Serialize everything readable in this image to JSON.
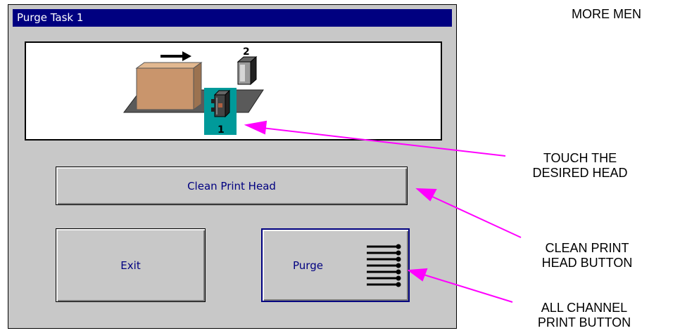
{
  "window": {
    "title": "Purge Task 1"
  },
  "scene": {
    "head_top_label": "2",
    "head_bottom_label": "1",
    "highlight_color": "#009a9a"
  },
  "buttons": {
    "clean_print_head": "Clean Print Head",
    "exit": "Exit",
    "purge": "Purge"
  },
  "callouts": {
    "more_menu": "MORE MEN",
    "touch_head_line1": "TOUCH THE",
    "touch_head_line2": "DESIRED HEAD",
    "clean_line1": "CLEAN PRINT",
    "clean_line2": "HEAD BUTTON",
    "all_channel_line1": "ALL CHANNEL",
    "all_channel_line2": "PRINT BUTTON",
    "arrow_color": "#ff00ff"
  }
}
